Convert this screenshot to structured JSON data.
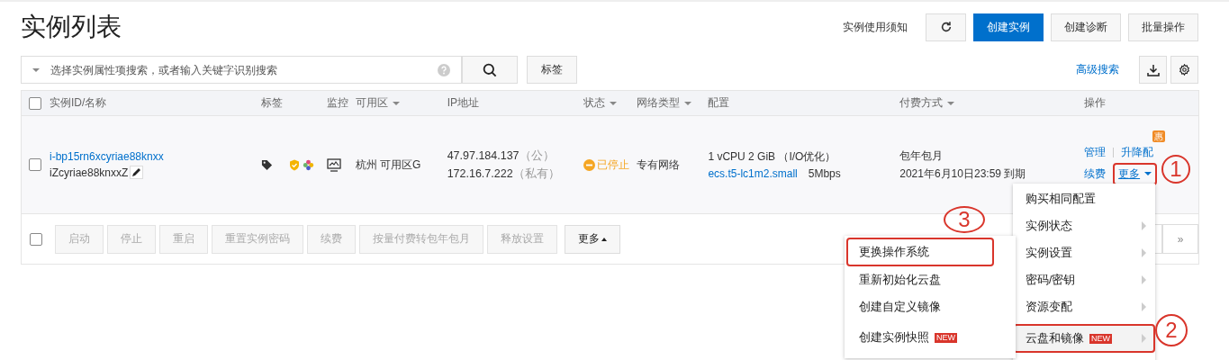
{
  "title": "实例列表",
  "top_actions": {
    "notice": "实例使用须知",
    "buttons": [
      {
        "kind": "refresh"
      },
      {
        "kind": "primary",
        "label": "创建实例"
      },
      {
        "kind": "default",
        "label": "创建诊断"
      },
      {
        "kind": "default",
        "label": "批量操作"
      }
    ]
  },
  "search": {
    "placeholder": "选择实例属性项搜索，或者输入关键字识别搜索",
    "tag_button": "标签",
    "advanced": "高级搜索"
  },
  "table": {
    "header_checked": false,
    "columns": [
      {
        "label": "实例ID/名称",
        "sortable": false
      },
      {
        "label": "标签",
        "sortable": false
      },
      {
        "label": "监控",
        "sortable": false
      },
      {
        "label": "可用区",
        "sortable": true
      },
      {
        "label": "IP地址",
        "sortable": false
      },
      {
        "label": "状态",
        "sortable": true
      },
      {
        "label": "网络类型",
        "sortable": true
      },
      {
        "label": "配置",
        "sortable": false
      },
      {
        "label": "付费方式",
        "sortable": true
      },
      {
        "label": "操作",
        "sortable": false
      }
    ],
    "rows": [
      {
        "checked": false,
        "id": "i-bp15rn6xcyriae88knxx",
        "name": "iZcyriae88knxxZ",
        "zone": "杭州 可用区G",
        "ip_public": "47.97.184.137",
        "ip_public_note": "（公）",
        "ip_private": "172.16.7.222",
        "ip_private_note": "（私有）",
        "status": "已停止",
        "network": "专有网络",
        "spec": "1 vCPU 2 GiB （I/O优化）",
        "instance_type": "ecs.t5-lc1m2.small",
        "bandwidth": "5Mbps",
        "billing": "包年包月",
        "expiry": "2021年6月10日23:59 到期",
        "actions": {
          "manage": "管理",
          "resize": "升降配",
          "promo_badge": "惠",
          "renew": "续费",
          "more": "更多",
          "more_callout": "1"
        }
      }
    ]
  },
  "bulk": {
    "checked": false,
    "buttons": [
      {
        "label": "启动",
        "disabled": true
      },
      {
        "label": "停止",
        "disabled": true
      },
      {
        "label": "重启",
        "disabled": true
      },
      {
        "label": "重置实例密码",
        "disabled": true
      },
      {
        "label": "续费",
        "disabled": true
      },
      {
        "label": "按量付费转包年包月",
        "disabled": true
      },
      {
        "label": "释放设置",
        "disabled": true
      },
      {
        "label": "更多",
        "disabled": false
      }
    ]
  },
  "pagination": {
    "next": "»"
  },
  "menu": [
    {
      "label": "购买相同配置",
      "submenu": false,
      "selected": false
    },
    {
      "label": "实例状态",
      "submenu": true,
      "selected": false
    },
    {
      "label": "实例设置",
      "submenu": true,
      "selected": false
    },
    {
      "label": "密码/密钥",
      "submenu": true,
      "selected": false
    },
    {
      "label": "资源变配",
      "submenu": true,
      "selected": false
    },
    {
      "label": "云盘和镜像",
      "submenu": true,
      "selected": true,
      "new_badge": "NEW",
      "callout": "2"
    }
  ],
  "submenu": [
    {
      "label": "更换操作系统",
      "callout": "3"
    },
    {
      "label": "重新初始化云盘"
    },
    {
      "label": "创建自定义镜像"
    },
    {
      "label": "创建实例快照",
      "new_badge": "NEW"
    }
  ]
}
